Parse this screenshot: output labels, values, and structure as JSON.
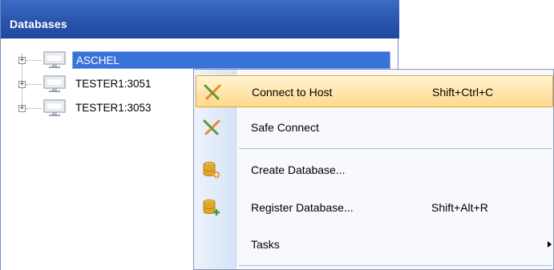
{
  "panel": {
    "title": "Databases"
  },
  "tree": {
    "nodes": [
      {
        "label": "ASCHEL",
        "selected": true,
        "icon": "computer-icon"
      },
      {
        "label": "TESTER1:3051",
        "selected": false,
        "icon": "computer-icon"
      },
      {
        "label": "TESTER1:3053",
        "selected": false,
        "icon": "computer-icon"
      }
    ]
  },
  "menu": {
    "items": [
      {
        "label": "Connect to Host",
        "shortcut": "Shift+Ctrl+C",
        "icon": "plug-connect-icon",
        "hover": true
      },
      {
        "label": "Safe Connect",
        "shortcut": "",
        "icon": "plug-safe-connect-icon"
      },
      {
        "label": "Create Database...",
        "shortcut": "",
        "icon": "database-create-icon"
      },
      {
        "label": "Register Database...",
        "shortcut": "Shift+Alt+R",
        "icon": "database-register-icon"
      },
      {
        "label": "Tasks",
        "shortcut": "",
        "icon": "",
        "submenu": true
      }
    ]
  },
  "colors": {
    "header": "#2a55ad",
    "selection": "#3a73d8",
    "menu_hover": "#ffd98a",
    "plug_green": "#5a9a3a",
    "plug_orange": "#e8892a",
    "database_gold": "#e0a52a"
  }
}
